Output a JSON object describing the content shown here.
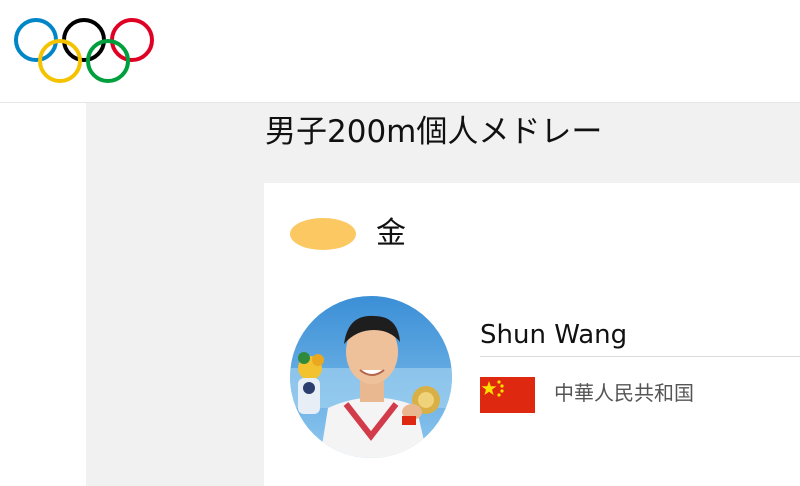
{
  "header": {
    "logo_icon": "olympic-rings-icon",
    "ring_colors": [
      "#0085c7",
      "#000000",
      "#df0024",
      "#f4c300",
      "#009f3d"
    ]
  },
  "event": {
    "title": "男子200m個人メドレー"
  },
  "result": {
    "medal_label": "金",
    "medal_color": "#fcc861",
    "athlete_name": "Shun Wang",
    "country_name": "中華人民共和国",
    "flag_icon": "china-flag-icon",
    "avatar_icon": "athlete-photo"
  },
  "colors": {
    "page_bg": "#f1f1f1",
    "card_bg": "#ffffff",
    "flag_red": "#de2910",
    "flag_yellow": "#ffde00"
  }
}
